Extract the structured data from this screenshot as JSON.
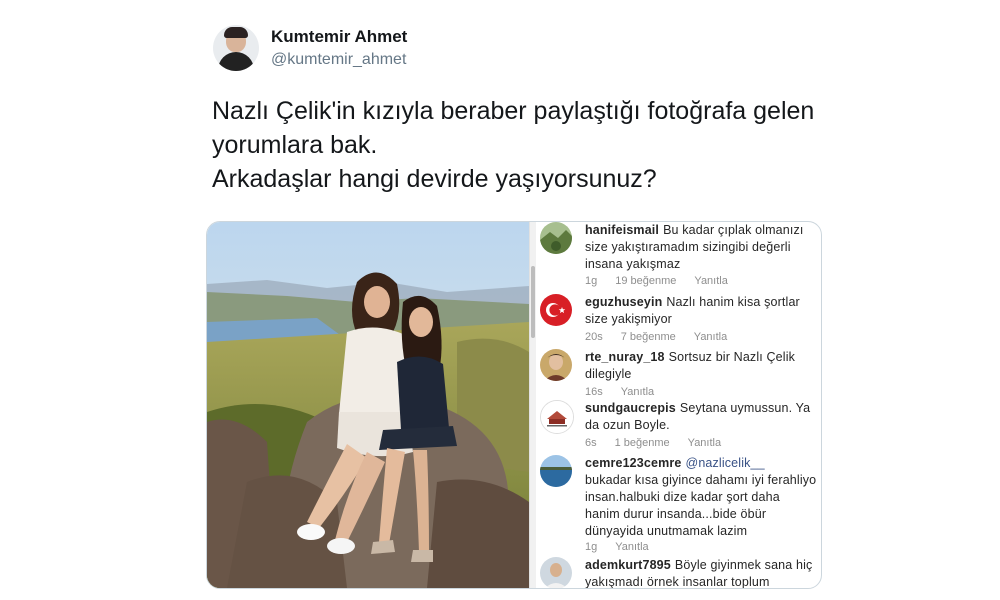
{
  "tweet": {
    "author_name": "Kumtemir Ahmet",
    "author_handle": "@kumtemir_ahmet",
    "text_lines": [
      "Nazlı Çelik'in kızıyla beraber paylaştığı fotoğrafa gelen",
      "yorumlara bak.",
      "Arkadaşlar hangi devirde yaşıyorsunuz?"
    ]
  },
  "comments": [
    {
      "username": "hanifeismail",
      "text": "Bu kadar çıplak olmanızı size yakıştıramadım sizingibi değerli insana yakışmaz",
      "time": "1g",
      "likes": "19 beğenme",
      "reply": "Yanıtla",
      "avatar_icon": "landscape-avatar-icon"
    },
    {
      "username": "eguzhuseyin",
      "text": "Nazlı hanim kisa şortlar size yakişmiyor",
      "time": "20s",
      "likes": "7 beğenme",
      "reply": "Yanıtla",
      "avatar_icon": "turkish-flag-avatar-icon"
    },
    {
      "username": "rte_nuray_18",
      "text": "Sortsuz bir Nazlı Çelik dilegiyle",
      "time": "16s",
      "likes": "",
      "reply": "Yanıtla",
      "avatar_icon": "person-avatar-icon"
    },
    {
      "username": "sundgaucrepis",
      "text": "Seytana uymussun. Ya da ozun Boyle.",
      "time": "6s",
      "likes": "1 beğenme",
      "reply": "Yanıtla",
      "avatar_icon": "logo-avatar-icon"
    },
    {
      "username": "cemre123cemre",
      "mention": "@nazlicelik__",
      "text": "bukadar kısa giyince dahamı iyi ferahliyo insan.halbuki dize kadar şort daha hanim durur insanda...bide öbür dünyayida unutmamak lazim",
      "time": "1g",
      "likes": "",
      "reply": "Yanıtla",
      "avatar_icon": "sea-avatar-icon"
    },
    {
      "username": "ademkurt7895",
      "text": "Böyle giyinmek sana hiç yakışmadı örnek insanlar toplum",
      "time": "",
      "likes": "",
      "reply": "",
      "avatar_icon": "man-avatar-icon"
    }
  ]
}
